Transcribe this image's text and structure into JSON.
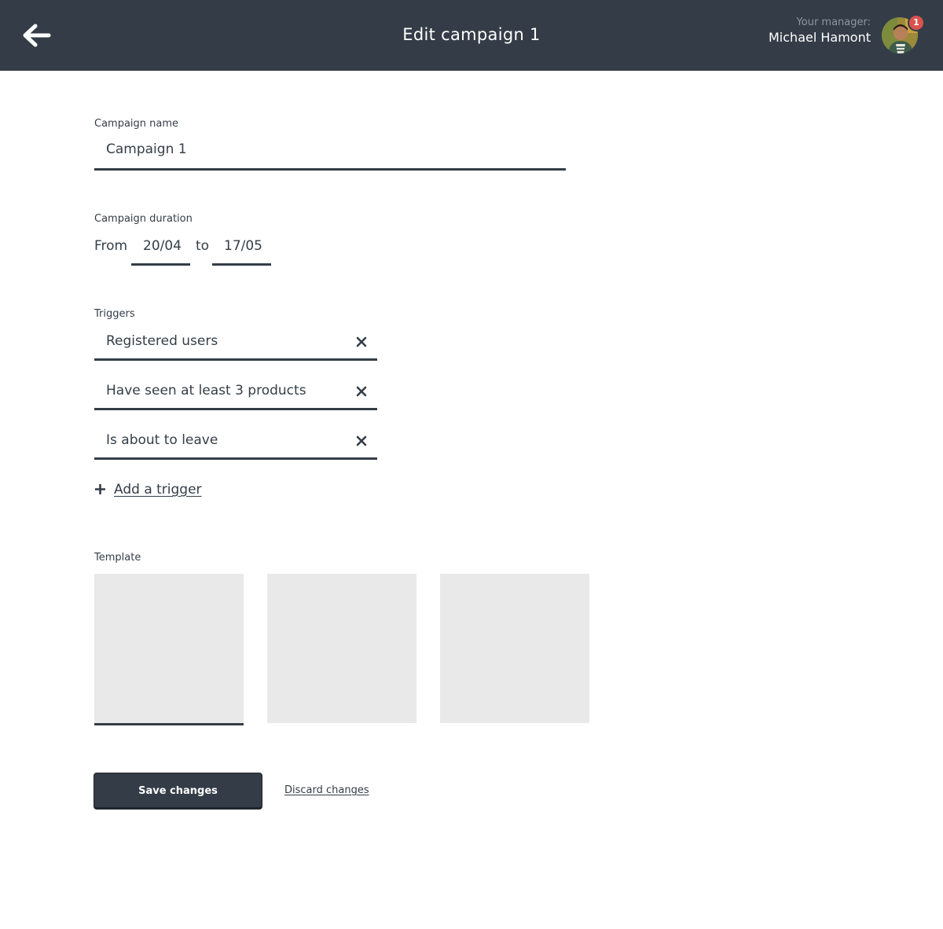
{
  "header": {
    "title": "Edit campaign 1",
    "manager_label": "Your manager:",
    "manager_name": "Michael Hamont",
    "notification_count": "1"
  },
  "form": {
    "campaign_name": {
      "label": "Campaign name",
      "value": "Campaign 1"
    },
    "duration": {
      "label": "Campaign duration",
      "from_label": "From",
      "from_value": "20/04",
      "to_label": "to",
      "to_value": "17/05"
    },
    "triggers": {
      "label": "Triggers",
      "items": [
        {
          "label": "Registered users"
        },
        {
          "label": "Have seen at least 3 products"
        },
        {
          "label": "Is about to leave"
        }
      ],
      "add_label": "Add a trigger"
    },
    "template": {
      "label": "Template",
      "selected_index": 0
    }
  },
  "actions": {
    "save_label": "Save changes",
    "discard_label": "Discard changes"
  },
  "colors": {
    "header_bg": "#343d47",
    "text": "#343d47",
    "badge": "#d9534f",
    "template_placeholder": "#e9e9e9"
  },
  "icons": {
    "back": "arrow-left-icon",
    "remove": "close-icon",
    "add": "plus-icon"
  }
}
